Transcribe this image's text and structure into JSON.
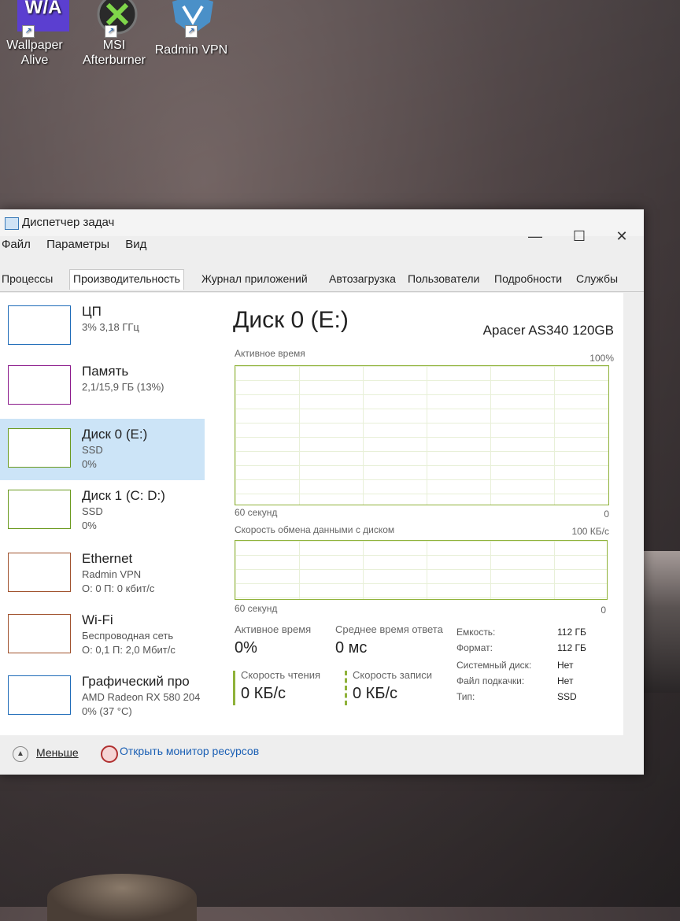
{
  "desktop": {
    "icons": [
      {
        "label_line1": "Wallpaper",
        "label_line2": "Alive",
        "logo_text": "W/A",
        "icon": "wallpaper-alive-icon"
      },
      {
        "label_line1": "MSI",
        "label_line2": "Afterburner",
        "icon": "msi-afterburner-icon"
      },
      {
        "label_line1": "Radmin VPN",
        "icon": "radmin-vpn-icon"
      }
    ]
  },
  "window": {
    "title": "Диспетчер задач",
    "controls": {
      "minimize": "—",
      "maximize": "☐",
      "close": "✕"
    }
  },
  "menu": [
    "Файл",
    "Параметры",
    "Вид"
  ],
  "tabs": [
    "Процессы",
    "Производительность",
    "Журнал приложений",
    "Автозагрузка",
    "Пользователи",
    "Подробности",
    "Службы"
  ],
  "active_tab": "Производительность",
  "devices": [
    {
      "name": "ЦП",
      "line1": "3% 3,18 ГГц",
      "line2": "",
      "color": "#1e6bb8",
      "selected": false
    },
    {
      "name": "Память",
      "line1": "2,1/15,9 ГБ (13%)",
      "line2": "",
      "color": "#8b1a8b",
      "selected": false
    },
    {
      "name": "Диск 0 (E:)",
      "line1": "SSD",
      "line2": "0%",
      "color": "#6b9a1e",
      "selected": true
    },
    {
      "name": "Диск 1 (C: D:)",
      "line1": "SSD",
      "line2": "0%",
      "color": "#6b9a1e",
      "selected": false
    },
    {
      "name": "Ethernet",
      "line1": "Radmin VPN",
      "line2": "О: 0 П: 0 кбит/с",
      "color": "#a0522d",
      "selected": false
    },
    {
      "name": "Wi-Fi",
      "line1": "Беспроводная сеть",
      "line2": "О: 0,1 П: 2,0 Мбит/с",
      "color": "#a0522d",
      "selected": false
    },
    {
      "name": "Графический про",
      "line1": "AMD Radeon RX 580 204",
      "line2": "0% (37 °C)",
      "color": "#1e6bb8",
      "selected": false
    }
  ],
  "detail": {
    "title": "Диск 0 (E:)",
    "model": "Apacer AS340 120GB",
    "graph1": {
      "label": "Активное время",
      "max": "100%",
      "time": "60 секунд",
      "min": "0"
    },
    "graph2": {
      "label": "Скорость обмена данными с диском",
      "max": "100 КБ/с",
      "time": "60 секунд",
      "min": "0"
    },
    "stats": {
      "active_time_label": "Активное время",
      "active_time_value": "0%",
      "response_label": "Среднее время ответа",
      "response_value": "0 мс",
      "read_label": "Скорость чтения",
      "read_value": "0 КБ/с",
      "write_label": "Скорость записи",
      "write_value": "0 КБ/с"
    },
    "properties": [
      {
        "key": "Емкость:",
        "value": "112 ГБ"
      },
      {
        "key": "Формат:",
        "value": "112 ГБ"
      },
      {
        "key": "Системный диск:",
        "value": "Нет"
      },
      {
        "key": "Файл подкачки:",
        "value": "Нет"
      },
      {
        "key": "Тип:",
        "value": "SSD"
      }
    ]
  },
  "footer": {
    "fewer_label": "Меньше",
    "resmon_label": "Открыть монитор ресурсов"
  }
}
